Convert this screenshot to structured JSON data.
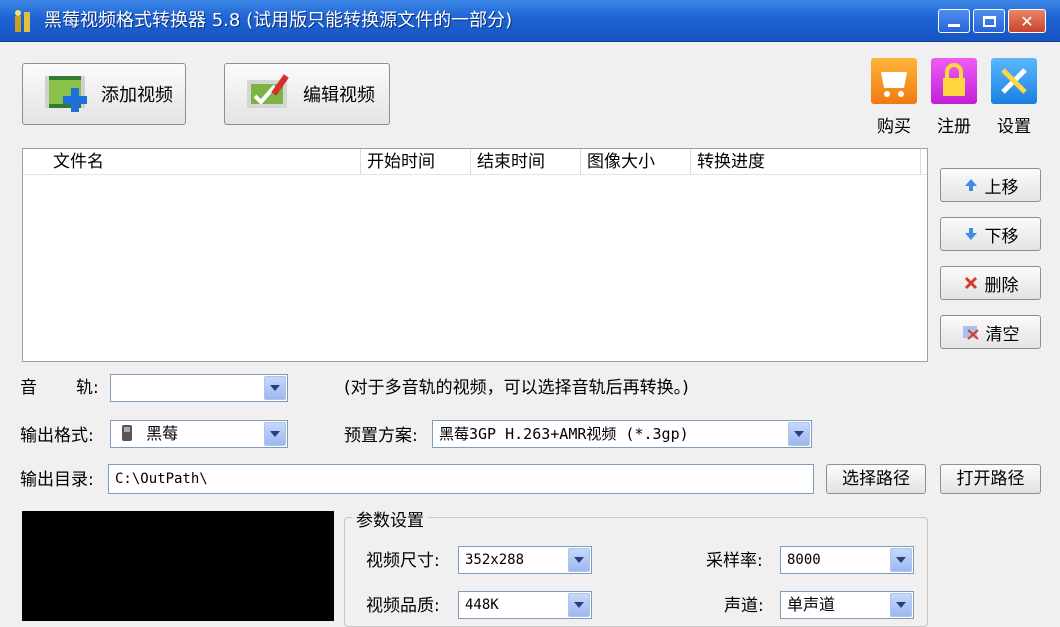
{
  "window": {
    "title": "黑莓视频格式转换器 5.8 (试用版只能转换源文件的一部分)"
  },
  "toolbar": {
    "add_video_label": "添加视频",
    "edit_video_label": "编辑视频"
  },
  "top_actions": {
    "buy_label": "购买",
    "register_label": "注册",
    "settings_label": "设置"
  },
  "file_list": {
    "columns": [
      "文件名",
      "开始时间",
      "结束时间",
      "图像大小",
      "转换进度"
    ]
  },
  "side_buttons": {
    "move_up": "上移",
    "move_down": "下移",
    "delete": "删除",
    "clear": "清空"
  },
  "audio_track": {
    "label_a": "音",
    "label_b": "轨:",
    "value": "",
    "hint": "(对于多音轨的视频，可以选择音轨后再转换。)"
  },
  "output_format": {
    "label": "输出格式:",
    "value": "黑莓"
  },
  "preset": {
    "label": "预置方案:",
    "value": "黑莓3GP H.263+AMR视频 (*.3gp)"
  },
  "output_dir": {
    "label": "输出目录:",
    "value": "C:\\OutPath\\",
    "choose_label": "选择路径",
    "open_label": "打开路径"
  },
  "params": {
    "group_title": "参数设置",
    "video_size_label": "视频尺寸:",
    "video_size_value": "352x288",
    "sample_rate_label": "采样率:",
    "sample_rate_value": "8000",
    "video_quality_label": "视频品质:",
    "video_quality_value": "448K",
    "channel_label": "声道:",
    "channel_value": "单声道"
  },
  "colors": {
    "titlebar": "#1d63d4",
    "buy_icon": "#f07a10",
    "register_icon": "#c020d8",
    "settings_icon": "#1a7fe0"
  }
}
